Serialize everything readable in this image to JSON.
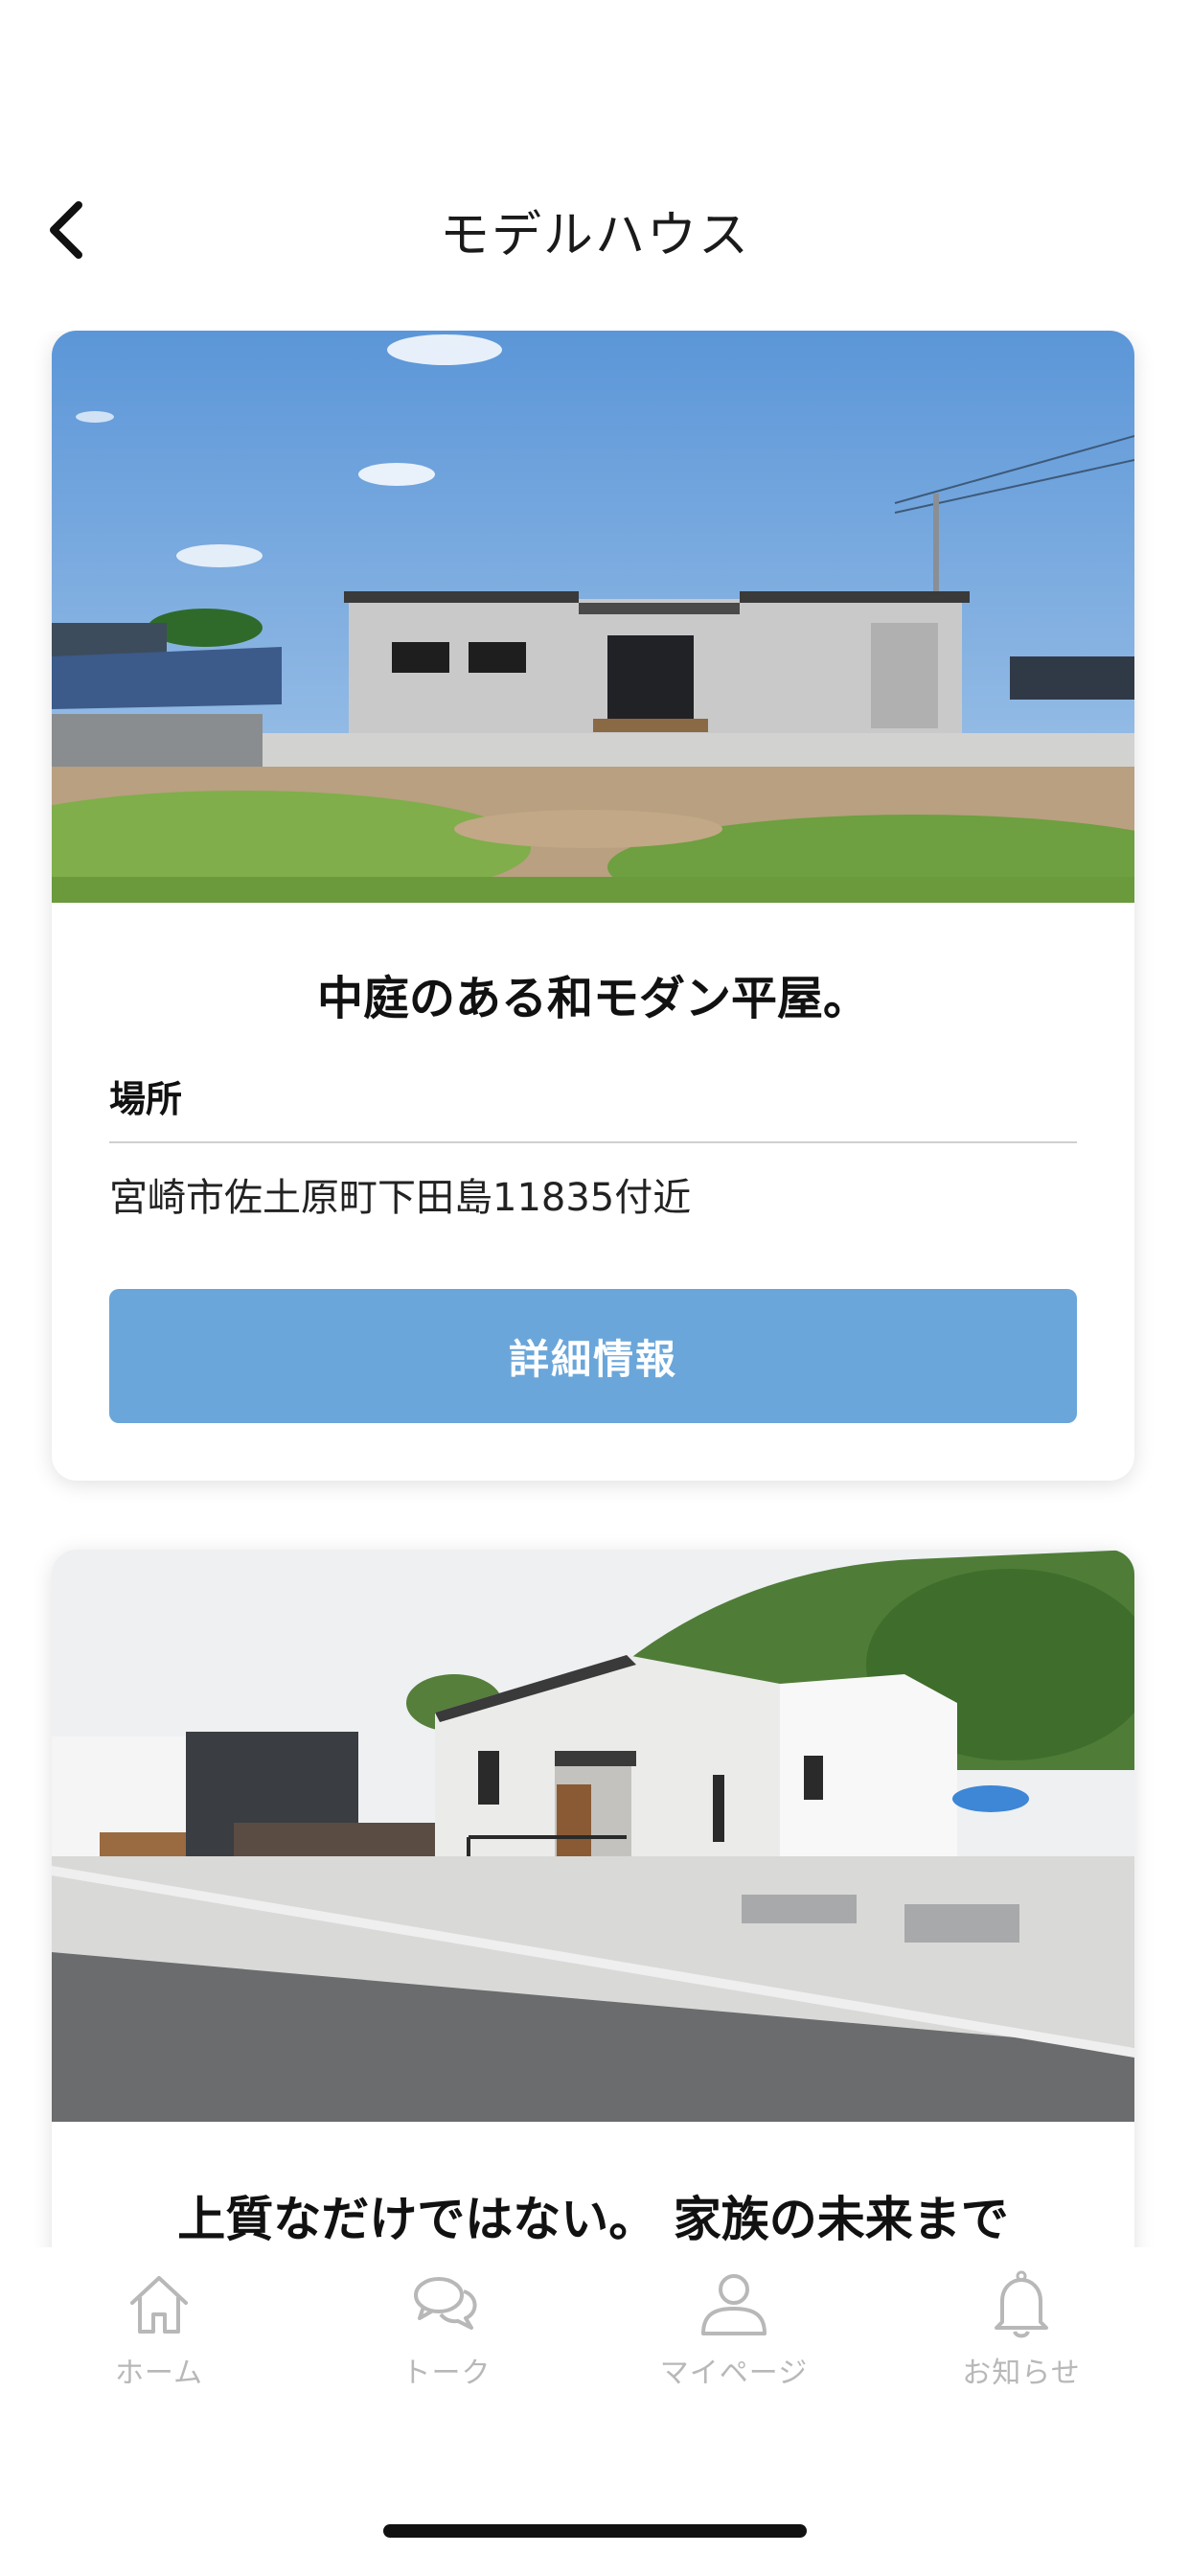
{
  "header": {
    "title": "モデルハウス"
  },
  "cards": [
    {
      "title": "中庭のある和モダン平屋。",
      "location_label": "場所",
      "location_value": "宮崎市佐土原町下田島11835付近",
      "button_label": "詳細情報"
    },
    {
      "title": "上質なだけではない。 家族の未来まで"
    }
  ],
  "tabbar": {
    "items": [
      {
        "label": "ホーム",
        "icon": "home-icon"
      },
      {
        "label": "トーク",
        "icon": "chat-bubbles-icon"
      },
      {
        "label": "マイページ",
        "icon": "user-icon"
      },
      {
        "label": "お知らせ",
        "icon": "bell-icon"
      }
    ]
  },
  "colors": {
    "accent_button": "#6aa6da",
    "tab_inactive": "#b8b8b8"
  }
}
